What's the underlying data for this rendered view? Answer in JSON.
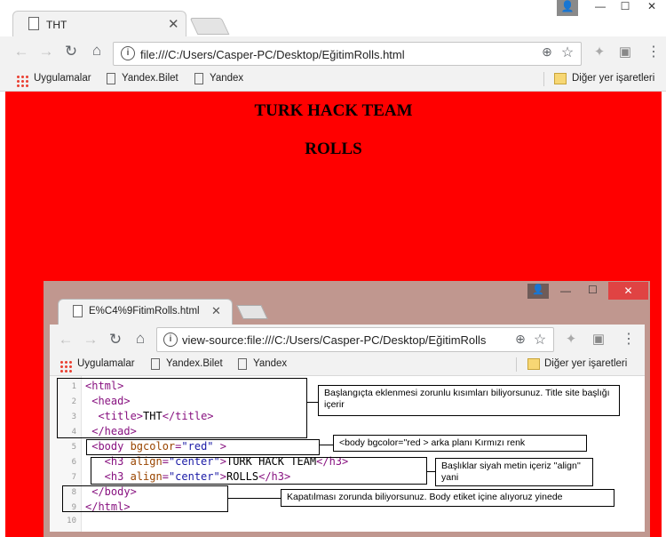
{
  "outer": {
    "tab_title": "THT",
    "url": "file:///C:/Users/Casper-PC/Desktop/EğitimRolls.html",
    "bookmarks": [
      "Uygulamalar",
      "Yandex.Bilet",
      "Yandex"
    ],
    "other_bookmarks": "Diğer yer işaretleri",
    "page_bg": "#ff0000",
    "headings": [
      "TURK HACK TEAM",
      "ROLLS"
    ]
  },
  "inner": {
    "tab_title": "E%C4%9FitimRolls.html",
    "url": "view-source:file:///C:/Users/Casper-PC/Desktop/EğitimRolls",
    "bookmarks": [
      "Uygulamalar",
      "Yandex.Bilet",
      "Yandex"
    ],
    "other_bookmarks": "Diğer yer işaretleri",
    "line_numbers": [
      "1",
      "2",
      "3",
      "4",
      "5",
      "6",
      "7",
      "8",
      "9",
      "10"
    ],
    "code": {
      "l1": "<html>",
      "l2": " <head>",
      "l3_open": "  <title>",
      "l3_text": "THT",
      "l3_close": "</title>",
      "l4": " </head>",
      "l5_tag": " <body ",
      "l5_attr": "bgcolor",
      "l5_eq": "=",
      "l5_val": "\"red\"",
      "l5_end": " >",
      "l6_open": "   <h3 ",
      "l6_attr": "align",
      "l6_val": "\"center\"",
      "l6_text": "TURK HACK TEAM",
      "l6_close": "</h3>",
      "l7_text": "ROLLS",
      "l8": " </body>",
      "l9": "</html>"
    }
  },
  "notes": {
    "n1": "Başlangıçta eklenmesi zorunlu kısımları biliyorsunuz. Title site başlığı içerir",
    "n2": "<body bgcolor=''red > arka planı Kırmızı renk",
    "n3": "Başlıklar siyah metin içeriz ''align'' yani",
    "n4": "Kapatılması zorunda biliyorsunuz. Body etiket içine alıyoruz yinede"
  }
}
